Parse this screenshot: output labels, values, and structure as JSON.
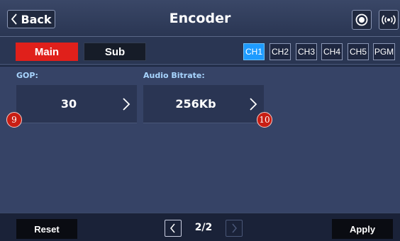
{
  "header": {
    "back_label": "Back",
    "title": "Encoder",
    "record_icon": "record-icon",
    "live_icon": "broadcast-icon"
  },
  "tabs": {
    "main": "Main",
    "sub": "Sub",
    "active": "Main"
  },
  "channels": {
    "items": [
      "CH1",
      "CH2",
      "CH3",
      "CH4",
      "CH5",
      "PGM"
    ],
    "active": "CH1",
    "active_color": "#1e9bff"
  },
  "fields": {
    "gop": {
      "label": "GOP:",
      "value": "30"
    },
    "audio_bitrate": {
      "label": "Audio Bitrate:",
      "value": "256Kb"
    }
  },
  "badges": {
    "gop": "9",
    "audio": "10"
  },
  "footer": {
    "reset_label": "Reset",
    "apply_label": "Apply",
    "page": "2/2"
  },
  "colors": {
    "accent_red": "#e0201b",
    "label_blue": "#a8d5ff"
  }
}
